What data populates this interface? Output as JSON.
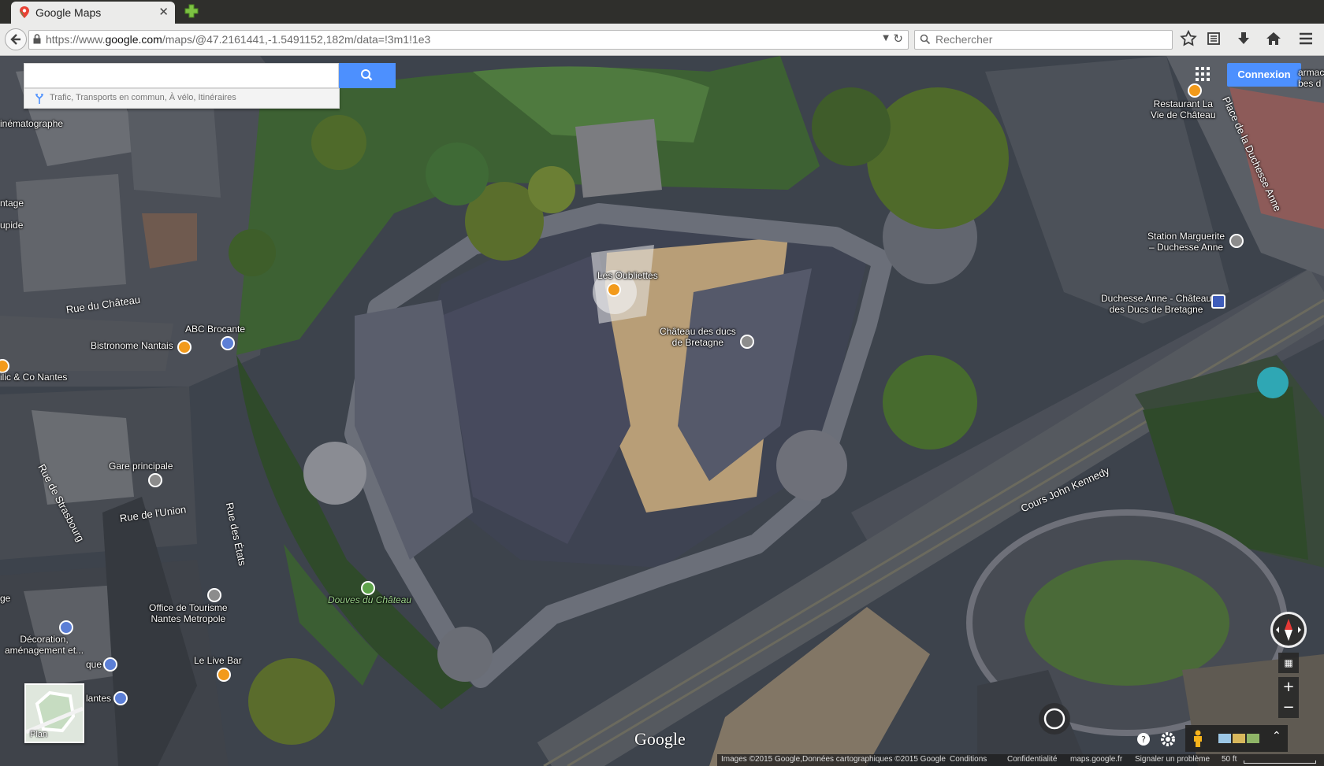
{
  "browser": {
    "tab_title": "Google Maps",
    "url_prefix": "https://www.",
    "url_host": "google.com",
    "url_path": "/maps/@47.2161441,-1.5491152,182m/data=!3m1!1e3",
    "search_placeholder": "Rechercher"
  },
  "maps": {
    "search_value": "",
    "directions_hint": "Trafic, Transports en commun, À vélo, Itinéraires",
    "signin_label": "Connexion",
    "plan_label": "Plan",
    "logo": "Google"
  },
  "places": {
    "cinematographe": "inématographe",
    "ntage": "ntage",
    "upide": "upide",
    "abc_brocante": "ABC Brocante",
    "bistronome": "Bistronome Nantais",
    "co_nantes": "ilic & Co Nantes",
    "gare_principale": "Gare principale",
    "les_oubliettes": "Les Oubliettes",
    "chateau_line1": "Château des ducs",
    "chateau_line2": "de Bretagne",
    "douves": "Douves du Château",
    "office_line1": "Office de Tourisme",
    "office_line2": "Nantes Metropole",
    "deco_line1": "Décoration,",
    "deco_line2": "aménagement et...",
    "ge": "ge",
    "que": "que",
    "lantes": "lantes",
    "live_bar": "Le Live Bar",
    "restaurant_line1": "Restaurant La",
    "restaurant_line2": "Vie de Château",
    "armac_line1": "armac",
    "armac_line2": "bes d",
    "station_line1": "Station Marguerite",
    "station_line2": "– Duchesse Anne",
    "tram_line1": "Duchesse Anne - Château",
    "tram_line2": "des Ducs de Bretagne"
  },
  "streets": {
    "rue_chateau": "Rue du Château",
    "rue_union": "Rue de l'Union",
    "rue_strasbourg": "Rue de Strasbourg",
    "rue_etats": "Rue des États",
    "place_duchesse": "Place de la Duchesse Anne",
    "cours_kennedy": "Cours John Kennedy"
  },
  "footer": {
    "images": "Images ©2015 Google,Données cartographiques ©2015 Google",
    "conditions": "Conditions",
    "confidentialite": "Confidentialité",
    "maps_link": "maps.google.fr",
    "report": "Signaler un problème",
    "scale": "50 ft"
  },
  "colors": {
    "accent_blue": "#4d90fe",
    "restaurant_pin": "#f29a1b",
    "shop_pin": "#5c7fd6"
  }
}
